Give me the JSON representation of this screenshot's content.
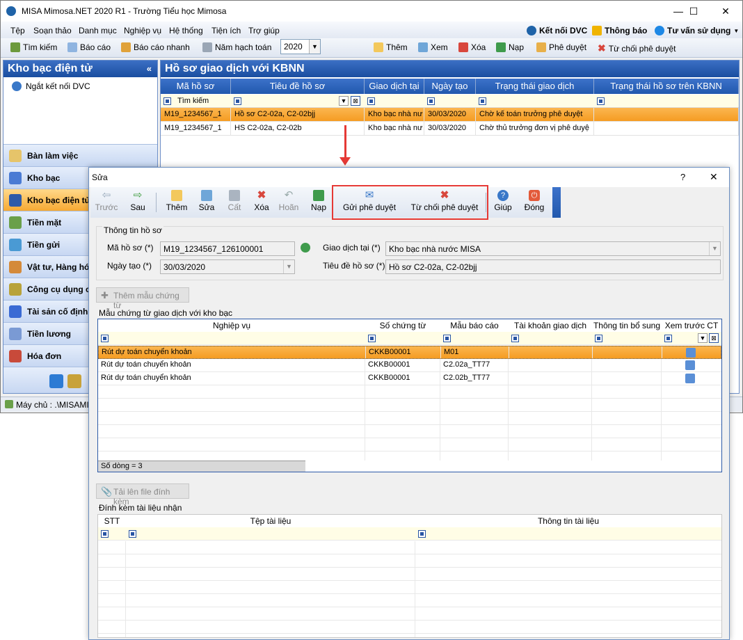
{
  "window": {
    "title": "MISA Mimosa.NET 2020 R1 - Trường Tiểu học Mimosa",
    "minimize": "—",
    "maximize": "☐",
    "close": "✕"
  },
  "menu": [
    "Tệp",
    "Soạn thảo",
    "Danh mục",
    "Nghiệp vụ",
    "Hệ thống",
    "Tiện ích",
    "Trợ giúp"
  ],
  "menu_right": {
    "connect_dvc": "Kết nối DVC",
    "notifications": "Thông báo",
    "consult": "Tư vấn sử dụng"
  },
  "toolbar": {
    "search": "Tìm kiếm",
    "report": "Báo cáo",
    "quick_report": "Báo cáo nhanh",
    "fiscal_year_label": "Năm hạch toán",
    "fiscal_year": "2020",
    "add": "Thêm",
    "view": "Xem",
    "delete": "Xóa",
    "refresh": "Nạp",
    "approve": "Phê duyệt",
    "reject": "Từ chối phê duyệt"
  },
  "left_panel": {
    "title": "Kho bạc điện tử",
    "collapse": "«",
    "tree_item": "Ngắt kết nối DVC",
    "nav": [
      "Bàn làm việc",
      "Kho bạc",
      "Kho bạc điện tử",
      "Tiền mặt",
      "Tiền gửi",
      "Vật tư, Hàng hóa",
      "Công cụ dụng cụ",
      "Tài sản cố định",
      "Tiền lương",
      "Hóa đơn"
    ]
  },
  "main_grid": {
    "title": "Hồ sơ giao dịch với KBNN",
    "columns": [
      "Mã hồ sơ",
      "Tiêu đề hồ sơ",
      "Giao dịch tại",
      "Ngày tạo",
      "Trạng thái giao dịch",
      "Trạng thái hồ sơ trên KBNN"
    ],
    "filter_search": "Tìm kiếm",
    "rows": [
      [
        "M19_1234567_1",
        "Hồ sơ C2-02a, C2-02bjj",
        "Kho bạc nhà nư",
        "30/03/2020",
        "Chờ kế toán trưởng phê duyệt",
        ""
      ],
      [
        "M19_1234567_1",
        "HS C2-02a, C2-02b",
        "Kho bạc nhà nư",
        "30/03/2020",
        "Chờ thủ trưởng đơn vị phê duyệ",
        ""
      ]
    ]
  },
  "statusbar": {
    "server": "Máy chủ : .\\MISAMIM"
  },
  "dialog": {
    "title": "Sửa",
    "help": "?",
    "close": "✕",
    "toolbar": {
      "prev": "Trước",
      "next": "Sau",
      "add": "Thêm",
      "edit": "Sửa",
      "save": "Cất",
      "delete": "Xóa",
      "undo": "Hoãn",
      "refresh": "Nạp",
      "send_approval": "Gửi phê duyệt",
      "reject_approval": "Từ chối phê duyệt",
      "help": "Giúp",
      "close": "Đóng"
    },
    "info_section": "Thông tin hồ sơ",
    "fields": {
      "code_label": "Mã hồ sơ (*)",
      "code_value": "M19_1234567_126100001",
      "date_label": "Ngày tạo (*)",
      "date_value": "30/03/2020",
      "location_label": "Giao dịch tại (*)",
      "location_value": "Kho bạc nhà nước MISA",
      "title_label": "Tiêu đề hồ sơ (*)",
      "title_value": "Hồ sơ C2-02a, C2-02bjj"
    },
    "add_template_btn": "Thêm mẫu chứng từ",
    "templates_section": "Mẫu chứng từ giao dịch với kho bạc",
    "templates": {
      "columns": [
        "Nghiệp vụ",
        "Số chứng từ",
        "Mẫu báo cáo",
        "Tài khoản giao dịch",
        "Thông tin bổ sung",
        "Xem trước CT"
      ],
      "rows": [
        [
          "Rút dự toán chuyển khoản",
          "CKKB00001",
          "M01",
          "",
          ""
        ],
        [
          "Rút dự toán chuyển khoản",
          "CKKB00001",
          "C2.02a_TT77",
          "",
          ""
        ],
        [
          "Rút dự toán chuyển khoản",
          "CKKB00001",
          "C2.02b_TT77",
          "",
          ""
        ]
      ],
      "row_count": "Số dòng = 3"
    },
    "upload_btn": "Tải lên file đính kèm",
    "attach_section": "Đính kèm tài liệu nhận",
    "attachments": {
      "columns": [
        "STT",
        "Tệp tài liệu",
        "Thông tin tài liệu"
      ]
    }
  },
  "colors": {
    "header_blue": "#2158ad",
    "selected_orange": "#f59c22",
    "highlight_red": "#e53935"
  }
}
